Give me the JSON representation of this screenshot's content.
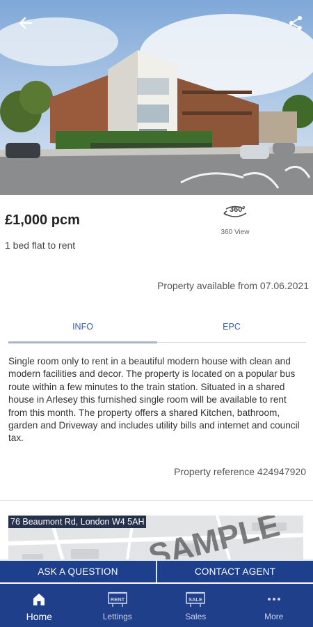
{
  "listing": {
    "price": "£1,000 pcm",
    "subtitle": "1 bed flat to rent",
    "view360_label": "360 View",
    "view360_badge": "360°",
    "available": "Property available from 07.06.2021",
    "description": "Single room only to rent in a beautiful modern house with clean and modern facilities and decor. The property is located on a popular bus route within a few minutes to the train station. Situated in a shared house in Arlesey this furnished single room will be available to rent from this month. The property offers a shared Kitchen, bathroom, garden and Driveway and includes utility bills and internet and council tax.",
    "reference": "Property reference 424947920"
  },
  "tabs": [
    {
      "label": "INFO",
      "active": true
    },
    {
      "label": "EPC",
      "active": false
    }
  ],
  "map": {
    "address": "76 Beaumont Rd, London W4 5AH",
    "watermark": "SAMPLE"
  },
  "actions": {
    "ask": "ASK A QUESTION",
    "contact": "CONTACT AGENT"
  },
  "nav": [
    {
      "label": "Home",
      "icon": "home-icon"
    },
    {
      "label": "Lettings",
      "icon": "rent-sign-icon",
      "badge": "RENT"
    },
    {
      "label": "Sales",
      "icon": "sale-sign-icon",
      "badge": "SALE"
    },
    {
      "label": "More",
      "icon": "more-dots-icon"
    }
  ],
  "colors": {
    "brand": "#1f3f8a",
    "tab_text": "#3b5aa6"
  }
}
